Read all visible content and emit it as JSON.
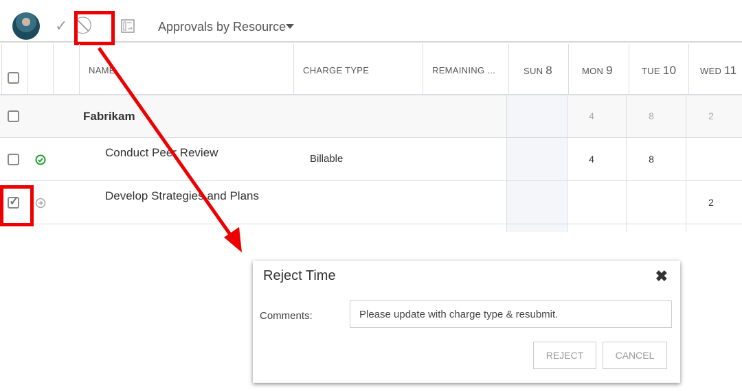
{
  "toolbar": {
    "view_title": "Approvals by Resource",
    "approve_icon": "check-icon",
    "reject_icon": "ban-icon",
    "layout_icon": "layout-icon"
  },
  "columns": {
    "name": "NAME",
    "charge_type": "CHARGE TYPE",
    "remaining": "REMAINING ...",
    "days": [
      {
        "dow": "SUN",
        "day": "8"
      },
      {
        "dow": "MON",
        "day": "9"
      },
      {
        "dow": "TUE",
        "day": "10"
      },
      {
        "dow": "WED",
        "day": "11"
      }
    ]
  },
  "rows": [
    {
      "name": "Fabrikam",
      "type": "group",
      "hours": [
        "",
        "4",
        "8",
        "2"
      ]
    },
    {
      "name": "Conduct Peer Review",
      "charge_type": "Billable",
      "status": "approved",
      "hours": [
        "",
        "4",
        "8",
        ""
      ]
    },
    {
      "name": "Develop Strategies and Plans",
      "charge_type": "",
      "status": "submitted",
      "checked": true,
      "hours": [
        "",
        "",
        "",
        "2"
      ]
    }
  ],
  "dialog": {
    "title": "Reject Time",
    "comments_label": "Comments:",
    "comments_value": "Please update with charge type & resubmit.",
    "reject": "REJECT",
    "cancel": "CANCEL"
  },
  "colors": {
    "annotation": "#ee0000",
    "approved": "#1a9c2a"
  }
}
